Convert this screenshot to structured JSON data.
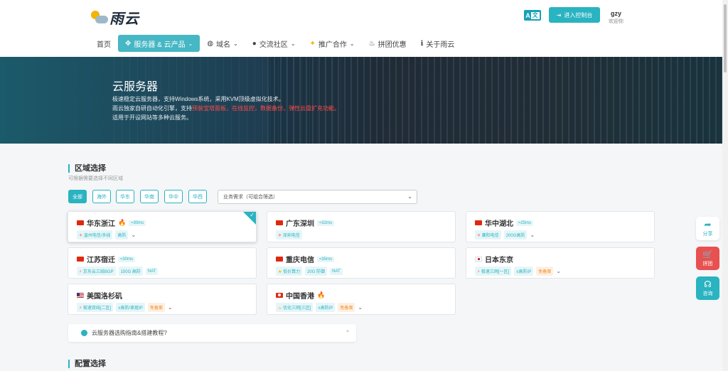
{
  "header": {
    "logo_text": "雨云",
    "lang_label": "A",
    "lang_box": "文",
    "console_icon": "login-icon",
    "console_label": "进入控制台",
    "user_name": "gzy",
    "user_welcome": "欢迎你"
  },
  "nav": {
    "home": "首页",
    "servers": "服务器 & 云产品",
    "domain": "域名",
    "community": "交流社区",
    "promote": "推广合作",
    "group": "拼团优惠",
    "about": "关于雨云"
  },
  "banner": {
    "title": "云服务器",
    "line1": "极速稳定云服务器，支持Windows系统，采用KVM顶级虚拟化技术。",
    "line2_prefix": "雨云独家自研自动化引擎，支持",
    "line2_highlight": "预装宝塔面板，在线监控，数据备份，弹性云盘扩充功能。",
    "line3": "适用于开设网站等多种云服务。"
  },
  "region_section": {
    "title": "区域选择",
    "subtitle": "可根据需要选择不同区域",
    "filters": [
      "全部",
      "海外",
      "华东",
      "华南",
      "华中",
      "华西"
    ],
    "select_placeholder": "业务需求（可组合筛选）"
  },
  "regions": [
    {
      "name": "华东浙江",
      "hot": "🔥",
      "latency": "≈30ms",
      "tags": [
        "温州电信/多线",
        "高防"
      ],
      "selected": true
    },
    {
      "name": "广东深圳",
      "latency": "≈32ms",
      "tags": [
        "深圳电信"
      ]
    },
    {
      "name": "华中湖北",
      "latency": "≈25ms",
      "tags": [
        "襄阳电信",
        "200G高防"
      ]
    },
    {
      "name": "江苏宿迁",
      "latency": "≈30ms",
      "tags": [
        "京东云三线BGP",
        "150G 高防",
        "NAT"
      ]
    },
    {
      "name": "重庆电信",
      "latency": "≈35ms",
      "tags": [
        "低价算力",
        "20G 防御",
        "NAT"
      ]
    },
    {
      "name": "日本东京",
      "tags": [
        "极速三网[一区]",
        "±高防IP",
        "免备案"
      ]
    },
    {
      "name": "美国洛杉矶",
      "tags": [
        "极速双线[二区]",
        "±高防/家庭IP",
        "免备案"
      ]
    },
    {
      "name": "中国香港",
      "hot": "🔥",
      "tags": [
        "优化三网[三区]",
        "±高防IP",
        "免备案"
      ]
    }
  ],
  "guide": {
    "label": "云服务器选购指南&搭建教程?"
  },
  "config_section": {
    "title": "配置选择"
  },
  "side": {
    "share": "分享",
    "group": "拼团",
    "consult": "咨询"
  },
  "colors": {
    "accent": "#2ab3c0",
    "highlight_red": "#ff4a4a",
    "tag_orange": "#f08a24"
  }
}
